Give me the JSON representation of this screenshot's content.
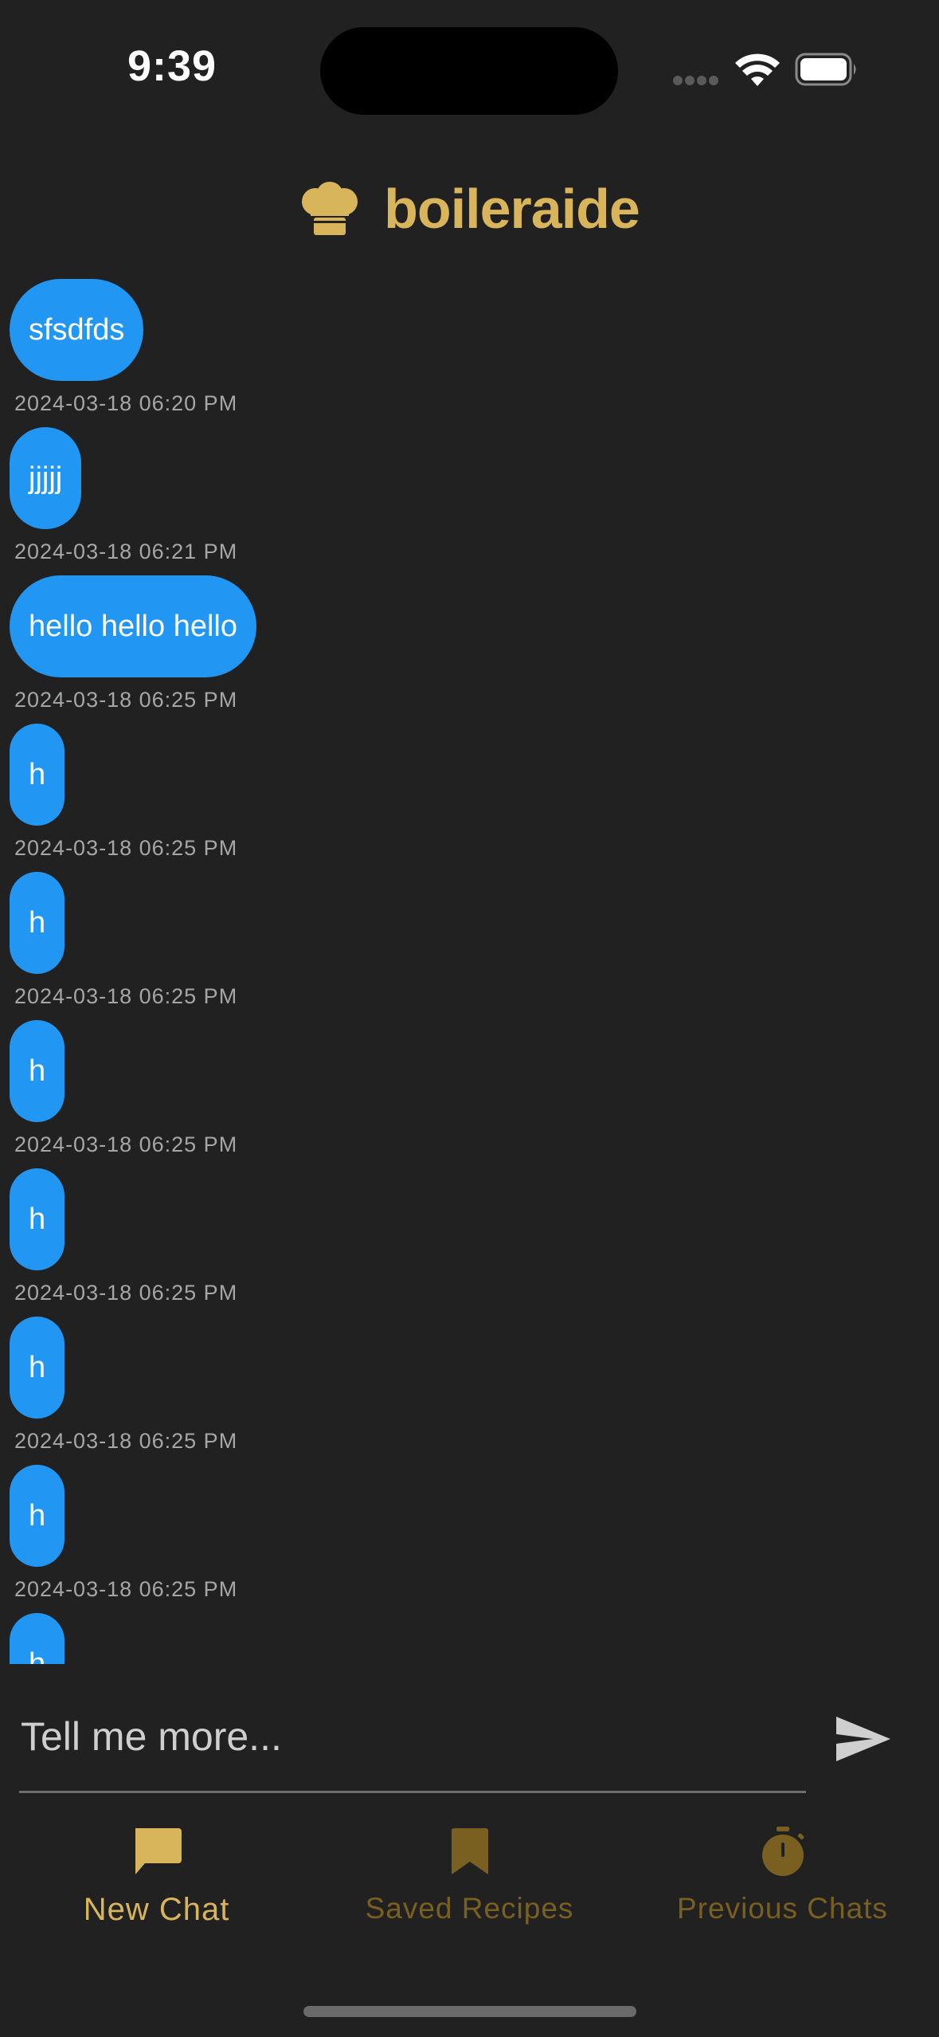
{
  "status_bar": {
    "time": "9:39"
  },
  "header": {
    "title": "boileraide",
    "icon": "chef-hat-icon"
  },
  "messages": [
    {
      "text": "sfsdfds",
      "timestamp": "2024-03-18 06:20 PM"
    },
    {
      "text": "jjjjj",
      "timestamp": "2024-03-18 06:21 PM"
    },
    {
      "text": "hello hello hello",
      "timestamp": "2024-03-18 06:25 PM"
    },
    {
      "text": "h",
      "timestamp": "2024-03-18 06:25 PM"
    },
    {
      "text": "h",
      "timestamp": "2024-03-18 06:25 PM"
    },
    {
      "text": "h",
      "timestamp": "2024-03-18 06:25 PM"
    },
    {
      "text": "h",
      "timestamp": "2024-03-18 06:25 PM"
    },
    {
      "text": "h",
      "timestamp": "2024-03-18 06:25 PM"
    },
    {
      "text": "h",
      "timestamp": "2024-03-18 06:25 PM"
    },
    {
      "text": "h",
      "timestamp": ""
    }
  ],
  "composer": {
    "placeholder": "Tell me more...",
    "send_icon": "send-icon"
  },
  "nav": [
    {
      "label": "New Chat",
      "icon": "chat-bubble-icon",
      "active": true
    },
    {
      "label": "Saved Recipes",
      "icon": "bookmark-icon",
      "active": false
    },
    {
      "label": "Previous Chats",
      "icon": "stopwatch-icon",
      "active": false
    }
  ],
  "colors": {
    "background": "#212121",
    "accent": "#d8b45a",
    "accent_inactive": "#7a6020",
    "bubble": "#2196f3",
    "timestamp": "#a6a6a6"
  }
}
